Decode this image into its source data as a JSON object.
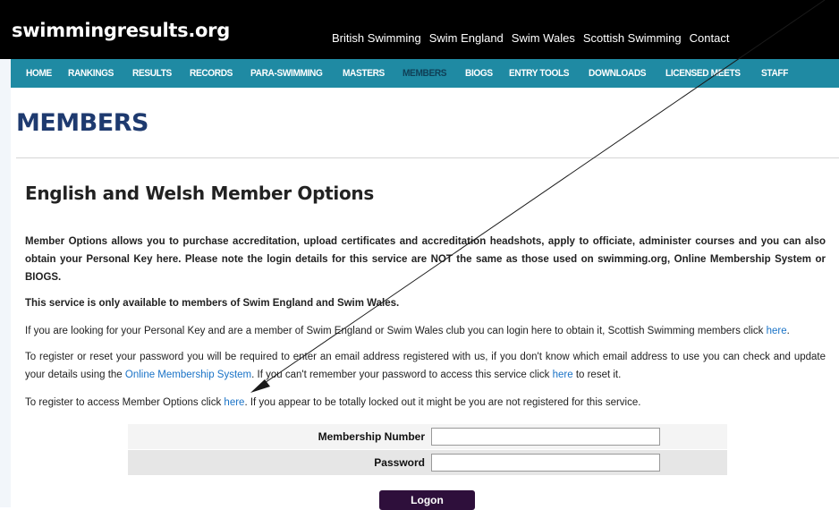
{
  "site": {
    "logo": "swimmingresults.org"
  },
  "top_links": [
    "British Swimming",
    "Swim England",
    "Swim Wales",
    "Scottish Swimming",
    "Contact"
  ],
  "nav": {
    "items": [
      "HOME",
      "RANKINGS",
      "RESULTS",
      "RECORDS",
      "PARA-SWIMMING",
      "MASTERS",
      "MEMBERS",
      "BIOGS",
      "ENTRY TOOLS",
      "DOWNLOADS",
      "LICENSED MEETS",
      "STAFF"
    ],
    "active": "MEMBERS"
  },
  "page": {
    "title": "MEMBERS",
    "section_title": "English and Welsh Member Options",
    "p1": "Member Options allows you to purchase accreditation, upload certificates and accreditation headshots, apply to officiate, administer courses and you can also obtain your Personal Key here. Please note the login details for this service are NOT the same as those used on swimming.org, Online Membership System or BIOGS.",
    "p2": "This service is only available to members of Swim England and Swim Wales.",
    "p3_text": "If you are looking for your Personal Key and are a member of Swim England or Swim Wales club you can login here to obtain it, Scottish Swimming members click ",
    "p3_link": "here",
    "p3_end": ".",
    "p4_text1": "To register or reset your password you will be required to enter an email address registered with us, if you don't know which email address to use you can check and update your details using the ",
    "p4_link1": "Online Membership System",
    "p4_text2": ". If you can't remember your password to access this service click ",
    "p4_link2": "here",
    "p4_text3": " to reset it.",
    "p5_text1": "To register to access Member Options click ",
    "p5_link": "here",
    "p5_text2": ". If you appear to be totally locked out it might be you are not registered for this service."
  },
  "login": {
    "membership_label": "Membership Number",
    "membership_value": "",
    "password_label": "Password",
    "password_value": "",
    "button_label": "Logon"
  },
  "colors": {
    "header_bg": "#000000",
    "nav_bg": "#1f8aa3",
    "nav_active": "#0f3f56",
    "title": "#1e3a6f",
    "link": "#1a73c7",
    "button_bg": "#2e0f3b"
  }
}
